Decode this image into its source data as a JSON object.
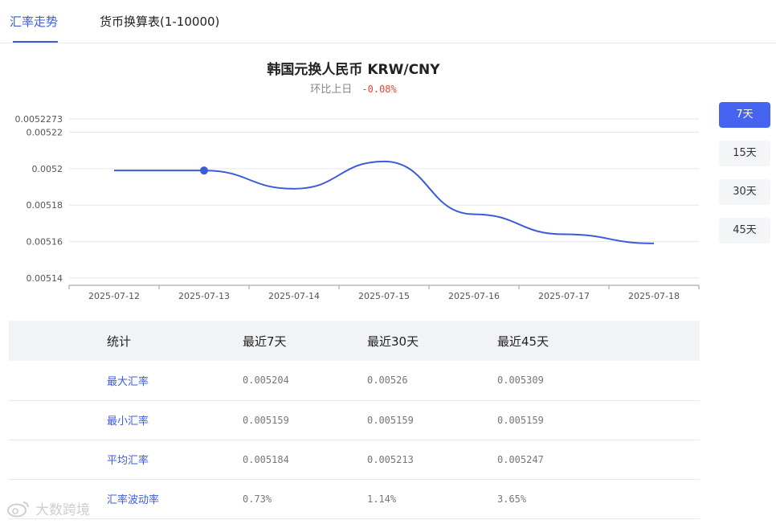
{
  "tabs": [
    {
      "label": "汇率走势",
      "active": true
    },
    {
      "label": "货币换算表(1-10000)",
      "active": false
    }
  ],
  "header": {
    "title": "韩国元换人民币   KRW/CNY",
    "change_label": "环比上日",
    "change_value": "-0.08%"
  },
  "range_buttons": [
    {
      "label": "7天",
      "active": true
    },
    {
      "label": "15天",
      "active": false
    },
    {
      "label": "30天",
      "active": false
    },
    {
      "label": "45天",
      "active": false
    }
  ],
  "chart_data": {
    "type": "line",
    "x": [
      "2025-07-12",
      "2025-07-13",
      "2025-07-14",
      "2025-07-15",
      "2025-07-16",
      "2025-07-17",
      "2025-07-18"
    ],
    "series": [
      {
        "values": [
          0.005199,
          0.005199,
          0.005189,
          0.005204,
          0.005175,
          0.005164,
          0.005159
        ]
      }
    ],
    "y_ticks": [
      "0.0052273",
      "0.00522",
      "0.0052",
      "0.00518",
      "0.00516",
      "0.00514"
    ],
    "ylim": [
      0.005136,
      0.0052273
    ],
    "highlight_index": 1,
    "line_color": "#3d5bd9",
    "grid": true
  },
  "stats": {
    "headers": [
      "统计",
      "最近7天",
      "最近30天",
      "最近45天"
    ],
    "rows": [
      [
        "最大汇率",
        "0.005204",
        "0.00526",
        "0.005309"
      ],
      [
        "最小汇率",
        "0.005159",
        "0.005159",
        "0.005159"
      ],
      [
        "平均汇率",
        "0.005184",
        "0.005213",
        "0.005247"
      ],
      [
        "汇率波动率",
        "0.73%",
        "1.14%",
        "3.65%"
      ]
    ]
  },
  "watermark": {
    "text": "大数跨境",
    "icon": "weibo-logo-icon"
  },
  "colors": {
    "accent": "#3d5bd9",
    "button_active": "#4464f1",
    "negative": "#e0453a"
  }
}
